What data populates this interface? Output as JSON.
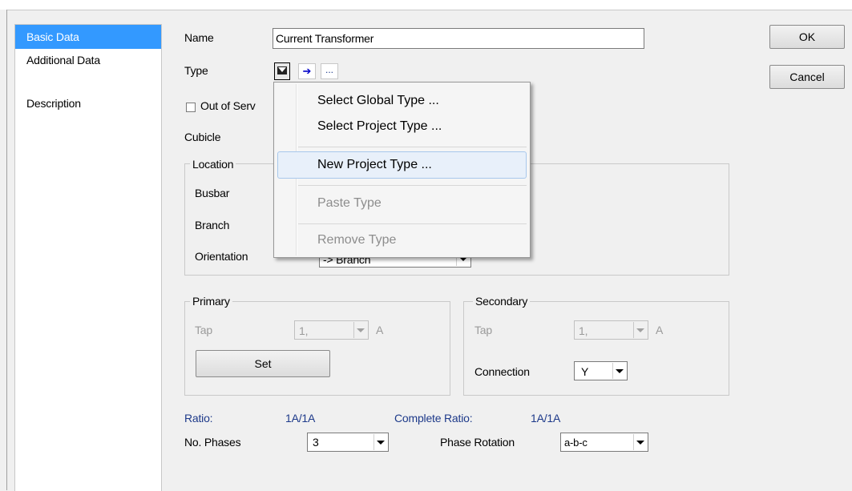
{
  "nav": {
    "items": [
      {
        "label": "Basic Data",
        "selected": true
      },
      {
        "label": "Additional Data",
        "selected": false
      },
      {
        "label": "Description",
        "selected": false
      }
    ]
  },
  "form": {
    "name_label": "Name",
    "name_value": "Current Transformer",
    "type_label": "Type",
    "type_ellipsis": "...",
    "out_of_service_label": "Out of Serv",
    "cubicle_label": "Cubicle"
  },
  "location": {
    "legend": "Location",
    "busbar_label": "Busbar",
    "branch_label": "Branch",
    "orientation_label": "Orientation",
    "orientation_value": "-> Branch"
  },
  "primary": {
    "legend": "Primary",
    "tap_label": "Tap",
    "tap_value": "1,",
    "tap_unit": "A",
    "set_button": "Set"
  },
  "secondary": {
    "legend": "Secondary",
    "tap_label": "Tap",
    "tap_value": "1,",
    "tap_unit": "A",
    "connection_label": "Connection",
    "connection_value": "Y"
  },
  "ratio": {
    "ratio_label": "Ratio:",
    "ratio_value": "1A/1A",
    "complete_label": "Complete Ratio:",
    "complete_value": "1A/1A"
  },
  "phases": {
    "label": "No. Phases",
    "value": "3",
    "rotation_label": "Phase Rotation",
    "rotation_value": "a-b-c"
  },
  "buttons": {
    "ok": "OK",
    "cancel": "Cancel"
  },
  "context_menu": {
    "items": [
      {
        "label": "Select Global Type ...",
        "enabled": true
      },
      {
        "label": "Select Project Type ...",
        "enabled": true
      },
      {
        "label": "New Project Type ...",
        "enabled": true,
        "highlighted": true
      },
      {
        "label": "Paste Type",
        "enabled": false
      },
      {
        "label": "Remove Type",
        "enabled": false
      }
    ]
  },
  "colors": {
    "selection": "#3399ff",
    "label_blue": "#1e3a8a",
    "disabled_text": "#9a9a9a"
  }
}
